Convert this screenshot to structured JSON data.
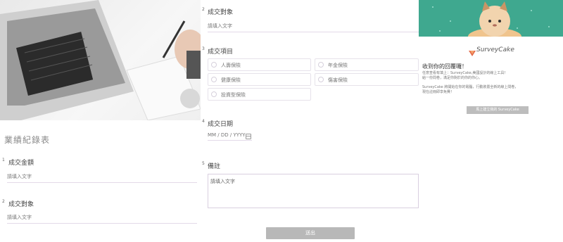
{
  "left": {
    "form_title": "業績紀錄表",
    "questions": [
      {
        "num": "1",
        "label": "成交金額",
        "placeholder": "請填入文字"
      },
      {
        "num": "2",
        "label": "成交對象",
        "placeholder": "請填入文字"
      }
    ]
  },
  "middle": {
    "q_target": {
      "num": "2",
      "label": "成交對象",
      "placeholder": "請填入文字"
    },
    "q_items": {
      "num": "3",
      "label": "成交項目",
      "options": [
        "人壽保險",
        "年金保險",
        "健康保險",
        "傷害保險",
        "投資型保險"
      ]
    },
    "q_date": {
      "num": "4",
      "label": "成交日期",
      "placeholder": "MM / DD / YYYY"
    },
    "q_note": {
      "num": "5",
      "label": "備註",
      "placeholder": "請填入文字"
    },
    "submit_label": "送出"
  },
  "right": {
    "brand": "SurveyCake",
    "thanks_title": "收到你的回覆囉！",
    "thanks_lines": [
      "任意查看有填上：SurveyCake,美國設計的線上工具！",
      "給一份問卷，滿足你對於的你的你心。",
      "SurveyCake 將開始在你的電腦，行動裝置全新的線上問卷，",
      "現在註冊即享免費！"
    ],
    "cta_label": "馬上建立我的 SurveyCake",
    "colors": {
      "teal": "#3fa88f",
      "accent": "#d9cfe0"
    }
  }
}
